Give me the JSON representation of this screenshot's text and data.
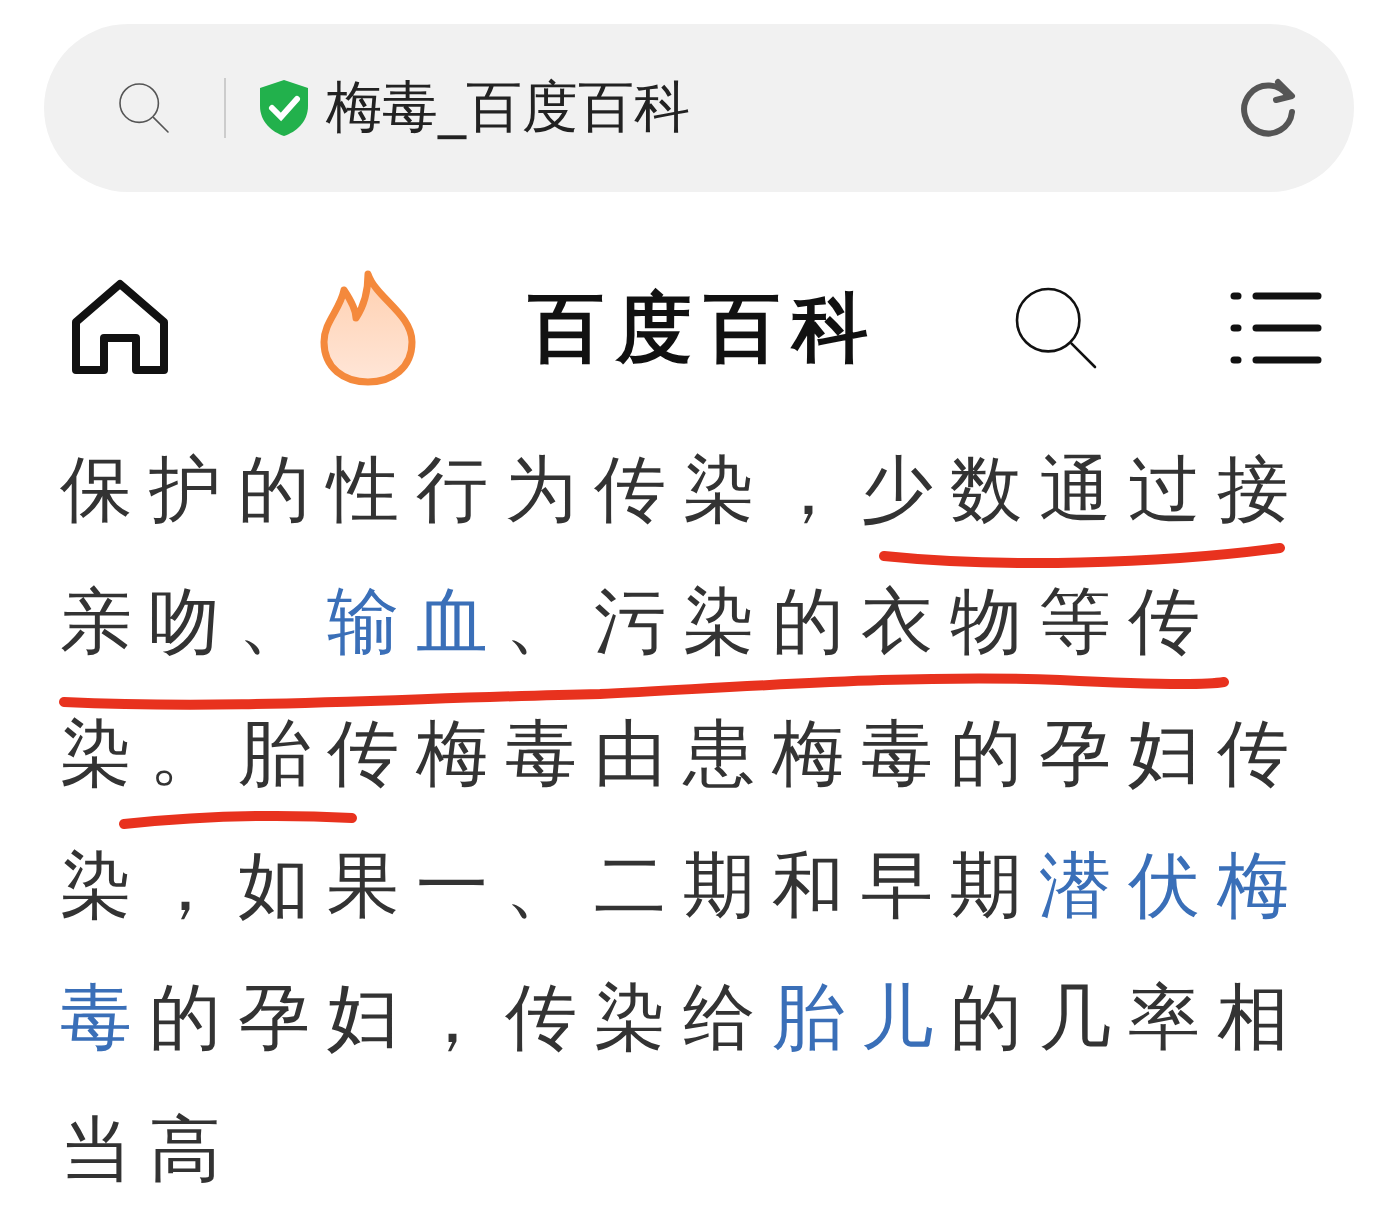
{
  "address_bar": {
    "title": "梅毒_百度百科",
    "secure": true
  },
  "site_nav": {
    "title": "百度百科"
  },
  "article": {
    "lines": [
      [
        {
          "kind": "text",
          "text": "保护的性行为传染，少数通过接"
        }
      ],
      [
        {
          "kind": "text",
          "text": "亲吻、"
        },
        {
          "kind": "link",
          "text": "输血"
        },
        {
          "kind": "text",
          "text": "、污染的衣物等传"
        }
      ],
      [
        {
          "kind": "text",
          "text": "染。胎传梅毒由患梅毒的孕妇传"
        }
      ],
      [
        {
          "kind": "text",
          "text": "染，如果一、二期和早期"
        },
        {
          "kind": "link",
          "text": "潜伏梅"
        }
      ],
      [
        {
          "kind": "link",
          "text": "毒"
        },
        {
          "kind": "text",
          "text": "的孕妇，传染给"
        },
        {
          "kind": "link",
          "text": "胎儿"
        },
        {
          "kind": "text",
          "text": "的几率相"
        }
      ],
      [
        {
          "kind": "text",
          "text": "当高"
        }
      ]
    ]
  }
}
